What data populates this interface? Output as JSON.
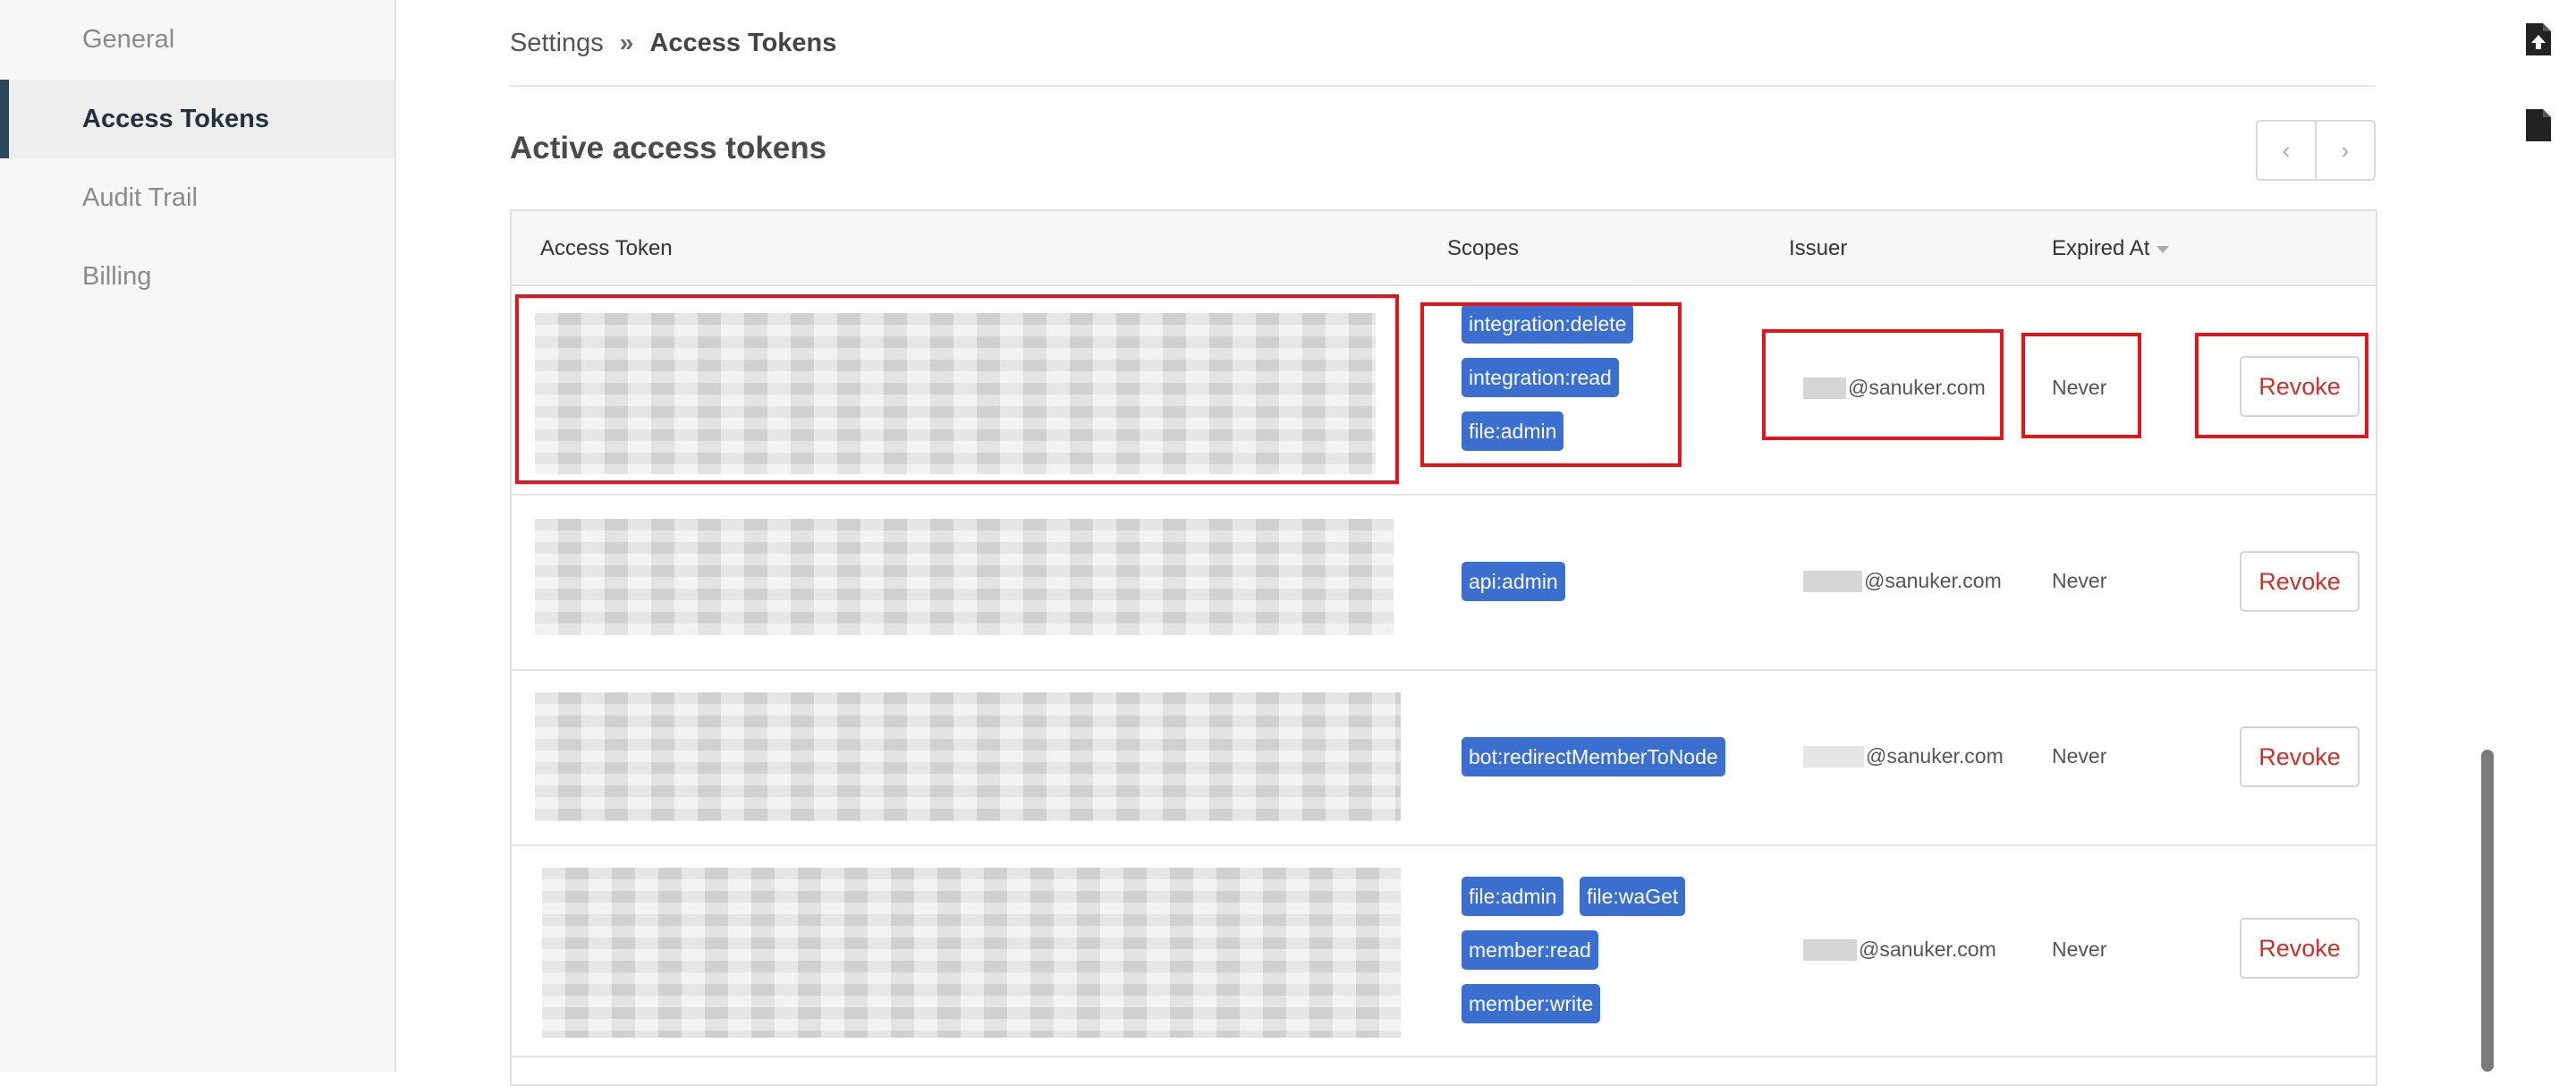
{
  "sidebar": {
    "items": [
      {
        "label": "General",
        "active": false
      },
      {
        "label": "Access Tokens",
        "active": true
      },
      {
        "label": "Audit Trail",
        "active": false
      },
      {
        "label": "Billing",
        "active": false
      }
    ]
  },
  "breadcrumb": {
    "parent": "Settings",
    "separator": "»",
    "current": "Access Tokens"
  },
  "section": {
    "title": "Active access tokens"
  },
  "pagination": {
    "prev_icon": "chevron-left-icon",
    "next_icon": "chevron-right-icon",
    "prev_glyph": "‹",
    "next_glyph": "›"
  },
  "table": {
    "columns": [
      "Access Token",
      "Scopes",
      "Issuer",
      "Expired At"
    ],
    "rows": [
      {
        "scopes": [
          "integration:delete",
          "integration:read",
          "file:admin"
        ],
        "issuer": "@sanuker.com",
        "expired": "Never",
        "action": "Revoke"
      },
      {
        "scopes": [
          "api:admin"
        ],
        "issuer": "@sanuker.com",
        "expired": "Never",
        "action": "Revoke"
      },
      {
        "scopes": [
          "bot:redirectMemberToNode"
        ],
        "issuer": "@sanuker.com",
        "expired": "Never",
        "action": "Revoke"
      },
      {
        "scopes": [
          "file:admin",
          "file:waGet",
          "member:read",
          "member:write"
        ],
        "issuer": "@sanuker.com",
        "expired": "Never",
        "action": "Revoke"
      }
    ]
  },
  "colors": {
    "scope_badge": "#3a6fd0",
    "revoke_text": "#c8322d",
    "highlight": "#e0161c",
    "active_nav_border": "#2c4858"
  },
  "toolbar": {
    "icons": [
      "file-upload-icon",
      "file-icon"
    ]
  }
}
